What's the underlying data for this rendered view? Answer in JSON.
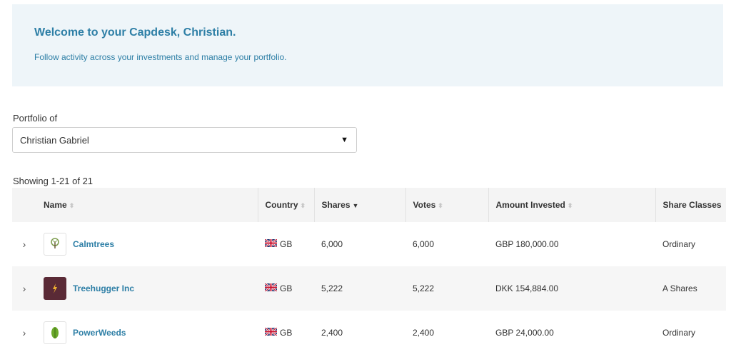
{
  "welcome": {
    "title": "Welcome to your Capdesk, Christian.",
    "subtitle": "Follow activity across your investments and manage your portfolio."
  },
  "portfolio": {
    "label": "Portfolio of",
    "selected": "Christian Gabriel"
  },
  "showing": "Showing 1-21 of 21",
  "table": {
    "columns": [
      "Name",
      "Country",
      "Shares",
      "Votes",
      "Amount Invested",
      "Share Classes"
    ],
    "sorted_column": "Shares",
    "rows": [
      {
        "name": "Calmtrees",
        "country": "GB",
        "shares": "6,000",
        "votes": "6,000",
        "amount": "GBP 180,000.00",
        "share_class": "Ordinary",
        "logo_icon": "tree-logo-icon"
      },
      {
        "name": "Treehugger Inc",
        "country": "GB",
        "shares": "5,222",
        "votes": "5,222",
        "amount": "DKK 154,884.00",
        "share_class": "A Shares",
        "logo_icon": "lightning-logo-icon"
      },
      {
        "name": "PowerWeeds",
        "country": "GB",
        "shares": "2,400",
        "votes": "2,400",
        "amount": "GBP 24,000.00",
        "share_class": "Ordinary",
        "logo_icon": "leaf-logo-icon"
      }
    ]
  },
  "colors": {
    "accent": "#2e7fa6",
    "welcome_bg": "#eef5f9"
  }
}
